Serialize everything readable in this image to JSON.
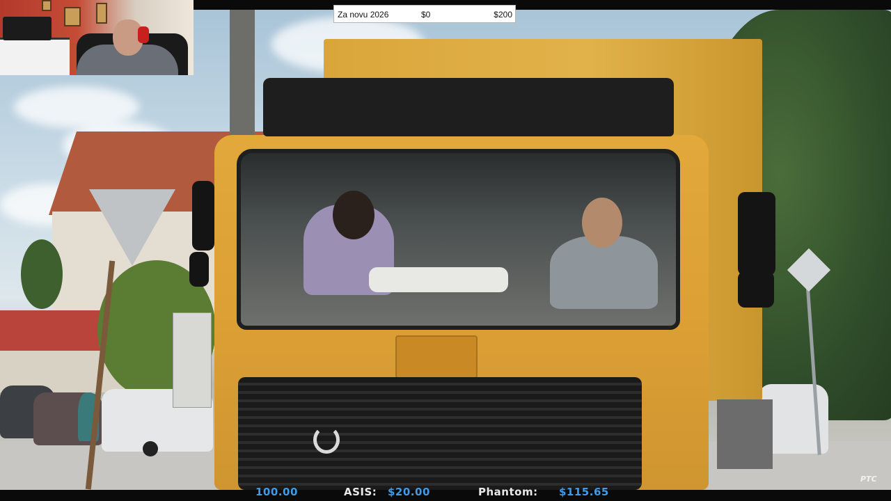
{
  "donation": {
    "label": "Za novu 2026",
    "current": "$0",
    "goal": "$200"
  },
  "ticker": {
    "first_value": "100.00",
    "asis_label": "ASIS:",
    "asis_value": "$20.00",
    "phantom_label": "Phantom:",
    "phantom_value": "$115.65"
  },
  "channel_logo": "PTC",
  "colors": {
    "ticker_value": "#3f9be8",
    "truck_yellow": "#e2a83a",
    "webcam_wall_red": "#b33a2c"
  }
}
